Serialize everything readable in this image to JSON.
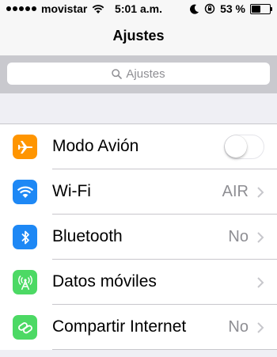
{
  "status_bar": {
    "carrier": "movistar",
    "time": "5:01 a.m.",
    "battery_percent": "53 %",
    "battery_level": 0.53,
    "signal_bars": 5
  },
  "nav": {
    "title": "Ajustes"
  },
  "search": {
    "placeholder": "Ajustes"
  },
  "settings": [
    {
      "label": "Modo Avión",
      "icon": "airplane-icon",
      "color": "#ff9500",
      "toggle": false
    },
    {
      "label": "Wi-Fi",
      "icon": "wifi-icon",
      "color": "#1e88f5",
      "value": "AIR"
    },
    {
      "label": "Bluetooth",
      "icon": "bluetooth-icon",
      "color": "#1e88f5",
      "value": "No"
    },
    {
      "label": "Datos móviles",
      "icon": "antenna-icon",
      "color": "#4cd964",
      "value": ""
    },
    {
      "label": "Compartir Internet",
      "icon": "hotspot-icon",
      "color": "#4cd964",
      "value": "No"
    }
  ]
}
